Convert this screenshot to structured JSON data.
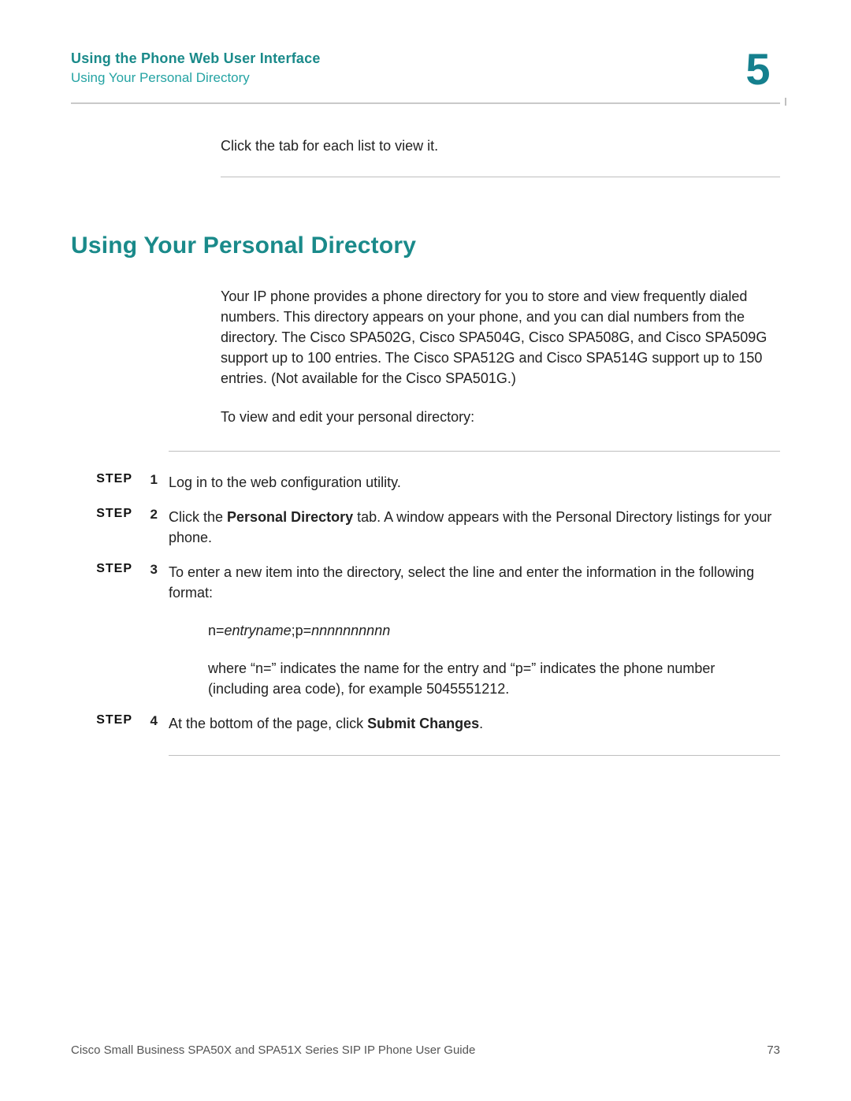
{
  "header": {
    "chapter_title": "Using the Phone Web User Interface",
    "section_name": "Using Your Personal Directory",
    "chapter_number": "5"
  },
  "intro_line": "Click the tab for each list to view it.",
  "section_heading": "Using Your Personal Directory",
  "intro_paragraph": "Your IP phone provides a phone directory for you to store and view frequently dialed numbers. This directory appears on your phone, and you can dial numbers from the directory. The Cisco SPA502G, Cisco SPA504G, Cisco SPA508G, and Cisco SPA509G support up to 100 entries. The Cisco SPA512G and Cisco SPA514G support up to 150 entries. (Not available for the Cisco SPA501G.)",
  "lead_in": "To view and edit your personal directory:",
  "step_label": "STEP",
  "steps": {
    "s1": {
      "num": "1",
      "text": "Log in to the web configuration utility."
    },
    "s2": {
      "num": "2",
      "pre": "Click the ",
      "bold": "Personal Directory",
      "post": " tab. A window appears with the Personal Directory listings for your phone."
    },
    "s3": {
      "num": "3",
      "text": "To enter a new item into the directory, select the line and enter the information in the following format:"
    },
    "s3_format": {
      "n_label": "n=",
      "n_val": "entryname",
      "sep": ";p=",
      "p_val": "nnnnnnnnnn"
    },
    "s3_explain": "where “n=” indicates the name for the entry and “p=” indicates the phone number (including area code), for example 5045551212.",
    "s4": {
      "num": "4",
      "pre": "At the bottom of the page, click ",
      "bold": "Submit Changes",
      "post": "."
    }
  },
  "footer": {
    "book_title": "Cisco Small Business SPA50X and SPA51X Series SIP IP Phone User Guide",
    "page_number": "73"
  }
}
